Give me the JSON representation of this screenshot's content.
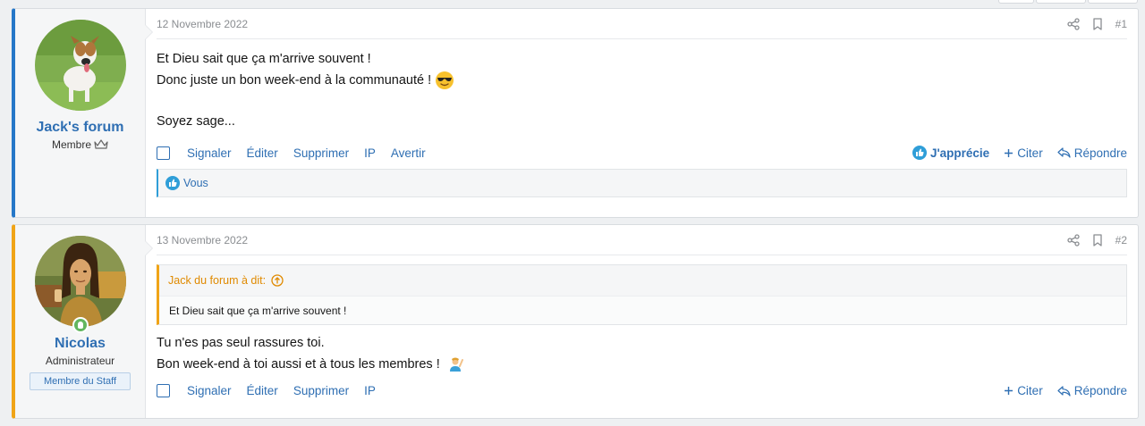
{
  "posts": [
    {
      "username": "Jack's forum",
      "user_title": "Membre",
      "date": "12 Novembre 2022",
      "number": "#1",
      "lines": [
        "Et Dieu sait que ça m'arrive souvent !",
        "Donc juste un bon week-end à la communauté !",
        "",
        "Soyez sage..."
      ],
      "actions": [
        "Signaler",
        "Éditer",
        "Supprimer",
        "IP",
        "Avertir"
      ],
      "like_label": "J'apprécie",
      "quote_label": "Citer",
      "reply_label": "Répondre",
      "reaction_text": "Vous"
    },
    {
      "username": "Nicolas",
      "user_title": "Administrateur",
      "staff_badge": "Membre du Staff",
      "date": "13 Novembre 2022",
      "number": "#2",
      "quote_author": "Jack du forum à dit:",
      "quote_text": "Et Dieu sait que ça m'arrive souvent !",
      "lines": [
        "Tu n'es pas seul rassures toi.",
        "Bon week-end à toi aussi et à tous les membres !"
      ],
      "actions": [
        "Signaler",
        "Éditer",
        "Supprimer",
        "IP"
      ],
      "quote_label": "Citer",
      "reply_label": "Répondre"
    }
  ],
  "colors": {
    "link": "#2f6fb3",
    "post1_accent": "#2577c8",
    "post2_accent": "#f0a417"
  },
  "icons": {
    "share": "share-icon",
    "bookmark": "bookmark-icon",
    "crown": "crown-icon",
    "like": "thumbs-up-icon",
    "plus": "plus-icon",
    "reply": "reply-icon",
    "sunglasses_emoji": "sunglasses-emoji-icon",
    "wave_emoji": "waving-person-emoji-icon",
    "quote_up": "arrow-up-circle-icon"
  }
}
